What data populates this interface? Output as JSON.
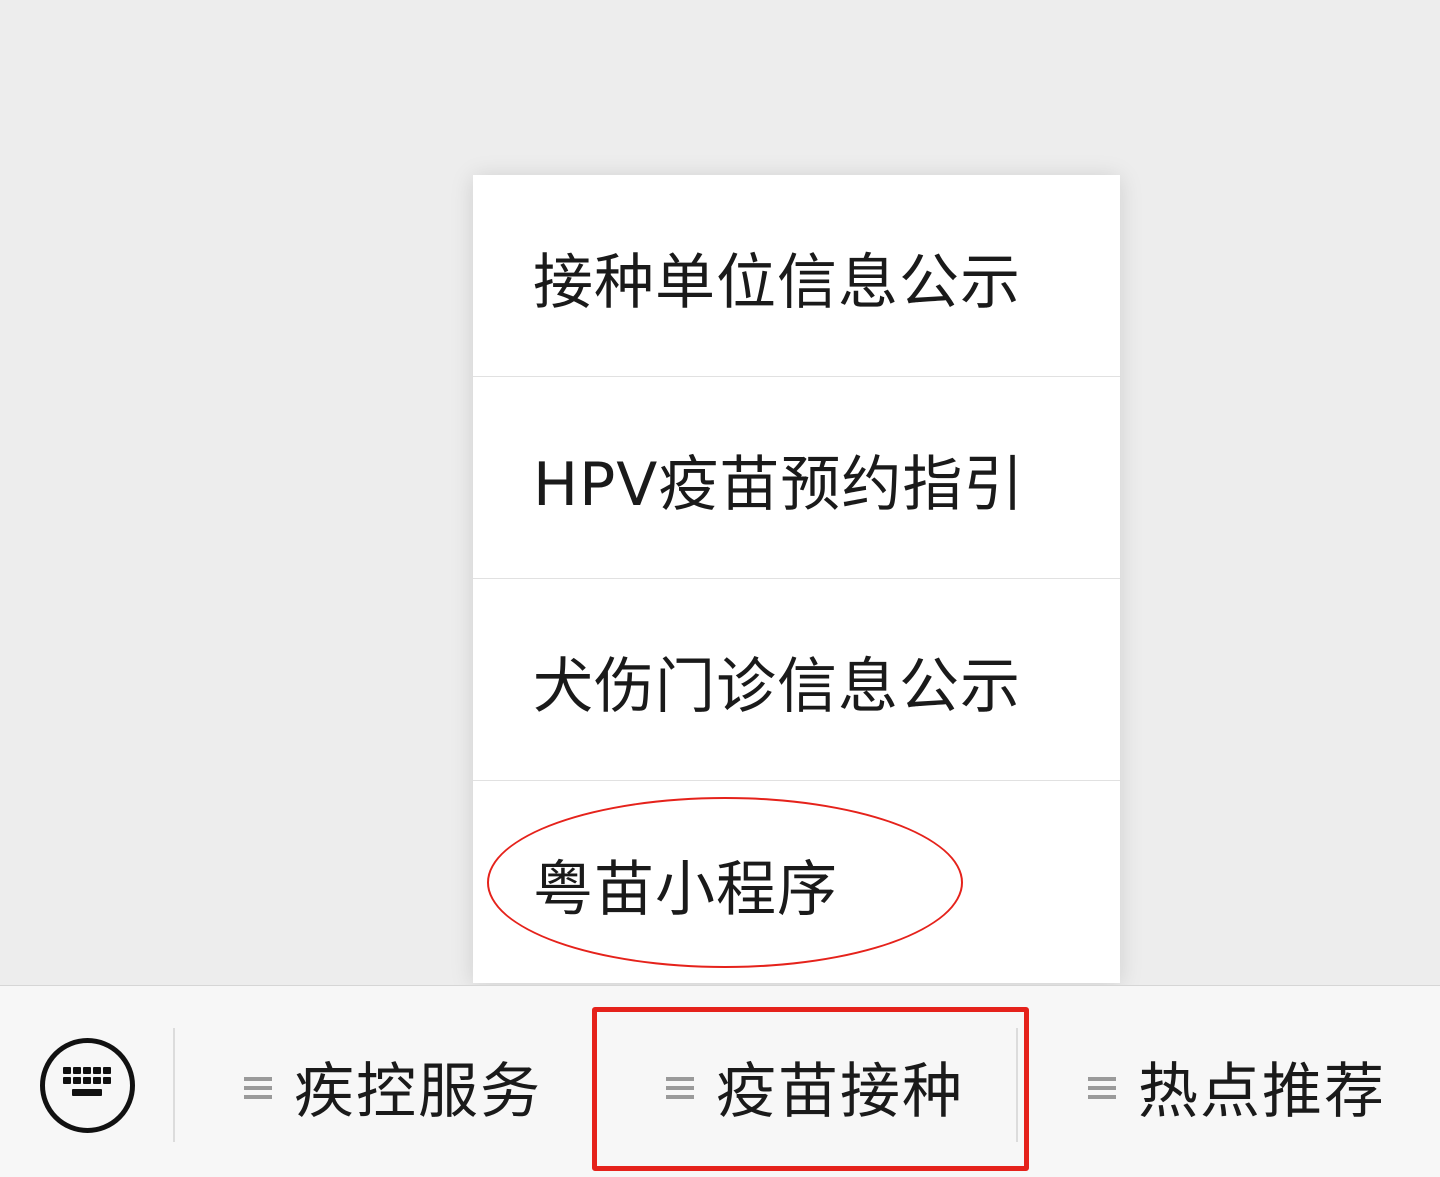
{
  "popup_menu": {
    "items": [
      {
        "label": "接种单位信息公示"
      },
      {
        "label": "HPV疫苗预约指引"
      },
      {
        "label": "犬伤门诊信息公示"
      },
      {
        "label": "粤苗小程序"
      }
    ]
  },
  "bottom_bar": {
    "keyboard_icon": "keyboard-icon",
    "menu_icon": "hamburger-menu-icon",
    "tabs": [
      {
        "label": "疾控服务"
      },
      {
        "label": "疫苗接种"
      },
      {
        "label": "热点推荐"
      }
    ]
  },
  "annotations": {
    "highlight_color": "#e5221b"
  },
  "colors": {
    "background": "#ededed",
    "menu_background": "#ffffff",
    "bar_background": "#f7f7f7",
    "text": "#1a1a1a",
    "icon_gray": "#9a9a9a"
  }
}
